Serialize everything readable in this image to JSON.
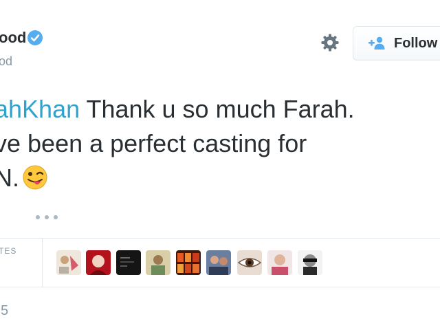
{
  "header": {
    "display_name": "ood",
    "handle": "od",
    "verified": true,
    "verified_color": "#55acee",
    "settings_icon": "gear-icon",
    "follow_button": {
      "label": "Follow",
      "icon": "add-user-icon",
      "icon_color": "#55acee"
    }
  },
  "tweet": {
    "lines": [
      {
        "mention": "ahKhan",
        "text": " Thank u so much Farah."
      },
      {
        "text": "ve been a perfect casting for"
      },
      {
        "text": "N.",
        "emoji": "winking-face-with-tongue"
      }
    ],
    "mention_color": "#2fa3cf",
    "more_icon": "more-dots-icon"
  },
  "favorites": {
    "label": "TES",
    "avatar_count": 9
  },
  "footer": {
    "timestamp": "5"
  },
  "colors": {
    "text": "#292f33",
    "muted": "#8899a6",
    "border": "#e1e8ed",
    "link": "#2fa3cf",
    "verified": "#55acee"
  }
}
